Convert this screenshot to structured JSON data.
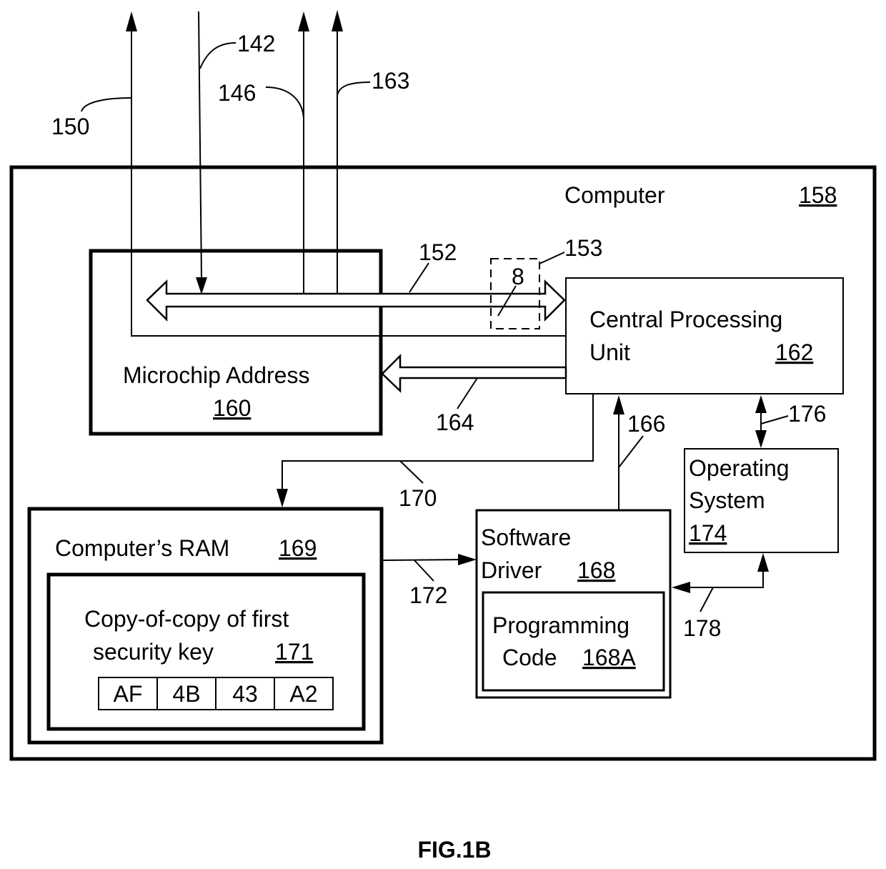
{
  "figure": {
    "caption": "FIG.1B",
    "colors": {
      "line": "#000000",
      "background": "#ffffff"
    }
  },
  "external_signals": [
    {
      "ref": "150",
      "direction": "out"
    },
    {
      "ref": "142",
      "direction": "in"
    },
    {
      "ref": "146",
      "direction": "out"
    },
    {
      "ref": "163",
      "direction": "out"
    }
  ],
  "computer": {
    "label": "Computer",
    "ref": "158"
  },
  "microchip": {
    "label": "Microchip Address",
    "ref": "160"
  },
  "cpu": {
    "label_line1": "Central Processing",
    "label_line2": "Unit",
    "ref": "162"
  },
  "bus": {
    "ref": "152",
    "width_ref": "153",
    "width_value": "8"
  },
  "connections": {
    "cpu_to_microchip": "164",
    "driver_to_cpu": "166",
    "cpu_to_ram": "170",
    "ram_to_driver": "172",
    "cpu_os": "176",
    "os_to_driver": "178"
  },
  "ram": {
    "label": "Computer’s RAM",
    "ref": "169",
    "key": {
      "label_line1": "Copy-of-copy of first",
      "label_line2": "security key",
      "ref": "171",
      "bytes": [
        "AF",
        "4B",
        "43",
        "A2"
      ]
    }
  },
  "driver": {
    "label_line1": "Software",
    "label_line2": "Driver",
    "ref": "168",
    "code": {
      "label_line1": "Programming",
      "label_line2": "Code",
      "ref": "168A"
    }
  },
  "os": {
    "label_line1": "Operating",
    "label_line2": "System",
    "ref": "174"
  }
}
